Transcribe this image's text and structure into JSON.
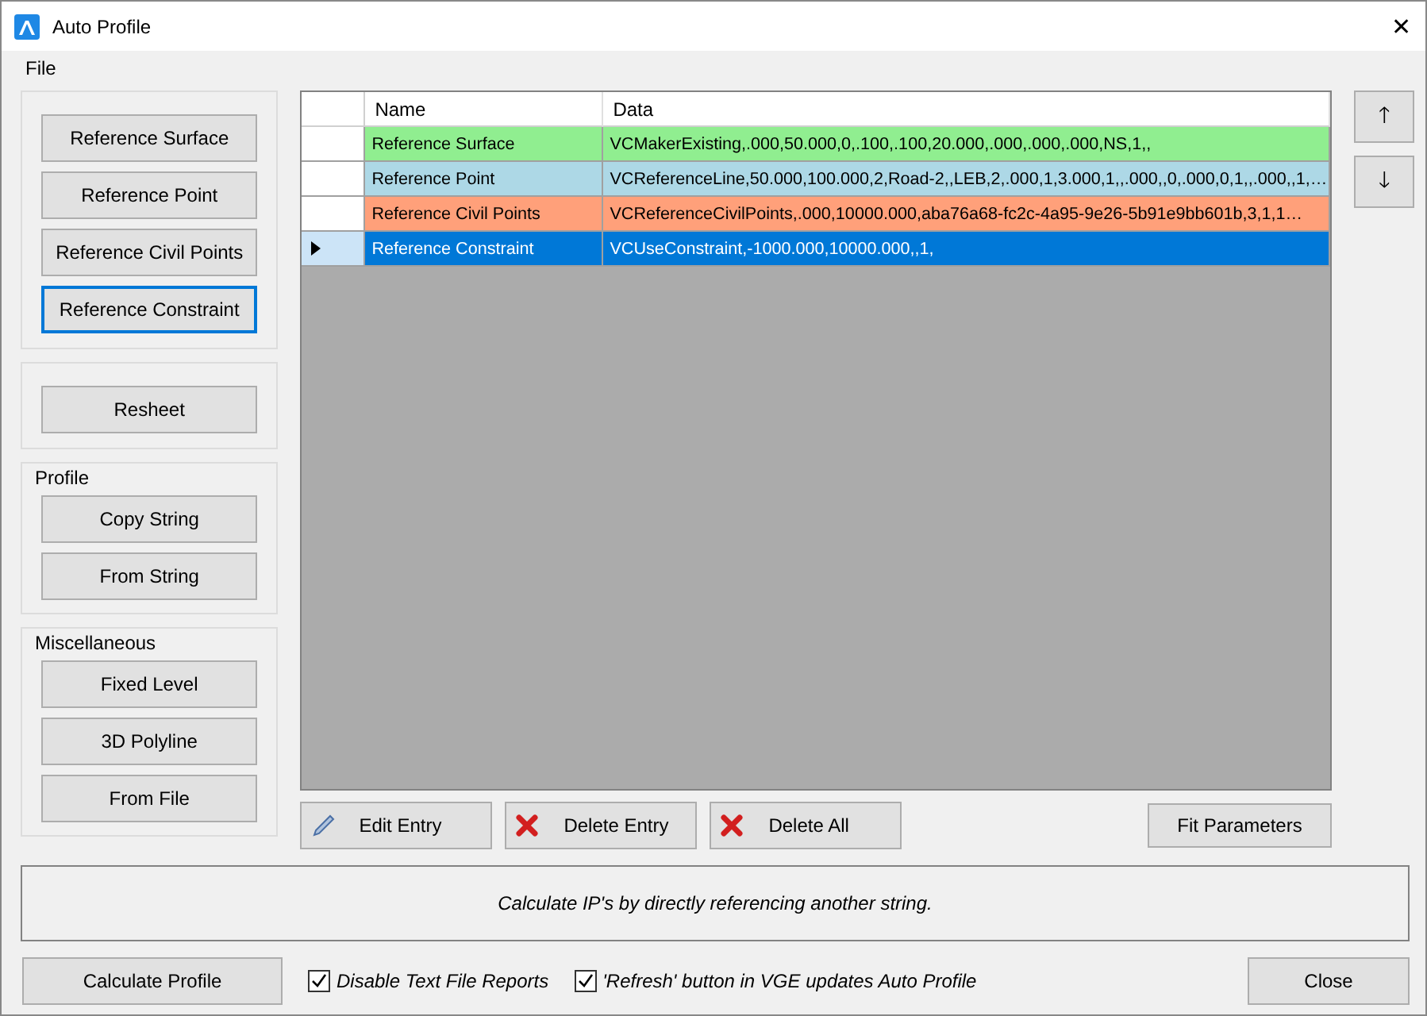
{
  "window": {
    "title": "Auto Profile",
    "close": "✕"
  },
  "menu": [
    "File"
  ],
  "groups": [
    {
      "buttons": [
        {
          "label": "Reference Surface",
          "focused": false
        },
        {
          "label": "Reference Point",
          "focused": false
        },
        {
          "label": "Reference Civil Points",
          "focused": false
        },
        {
          "label": "Reference Constraint",
          "focused": true
        }
      ]
    },
    {
      "buttons": [
        {
          "label": "Resheet",
          "focused": false
        }
      ]
    },
    {
      "label": "Profile",
      "buttons": [
        {
          "label": "Copy String",
          "focused": false
        },
        {
          "label": "From String",
          "focused": false
        }
      ]
    },
    {
      "label": "Miscellaneous",
      "buttons": [
        {
          "label": "Fixed Level",
          "focused": false
        },
        {
          "label": "3D Polyline",
          "focused": false
        },
        {
          "label": "From File",
          "focused": false
        }
      ]
    }
  ],
  "table": {
    "columns": [
      "Name",
      "Data"
    ],
    "rows": [
      {
        "name": "Reference Surface",
        "data": "VCMakerExisting,.000,50.000,0,.100,.100,20.000,.000,.000,.000,NS,1,,",
        "color": "#90ee90",
        "selected": false
      },
      {
        "name": "Reference Point",
        "data": "VCReferenceLine,50.000,100.000,2,Road-2,,LEB,2,.000,1,3.000,1,,.000,,0,.000,0,1,,.000,,1,…",
        "color": "#add8e6",
        "selected": false
      },
      {
        "name": "Reference Civil Points",
        "data": "VCReferenceCivilPoints,.000,10000.000,aba76a68-fc2c-4a95-9e26-5b91e9bb601b,3,1,1…",
        "color": "#ffa07a",
        "selected": false
      },
      {
        "name": "Reference Constraint",
        "data": "VCUseConstraint,-1000.000,10000.000,,1,",
        "selected": true
      }
    ]
  },
  "move_buttons": [
    "🡑",
    "🡓"
  ],
  "entry_buttons": [
    {
      "label": "Edit Entry",
      "kind": "edit"
    },
    {
      "label": "Delete Entry",
      "kind": "delete"
    },
    {
      "label": "Delete All",
      "kind": "delete"
    }
  ],
  "fit_button": "Fit Parameters",
  "description": "Calculate IP's by directly referencing another string.",
  "calculate_button": "Calculate Profile",
  "options": [
    {
      "label": "Disable Text File Reports",
      "checked": true
    },
    {
      "label": "'Refresh' button in VGE updates Auto Profile",
      "checked": true
    }
  ],
  "close_button": "Close"
}
